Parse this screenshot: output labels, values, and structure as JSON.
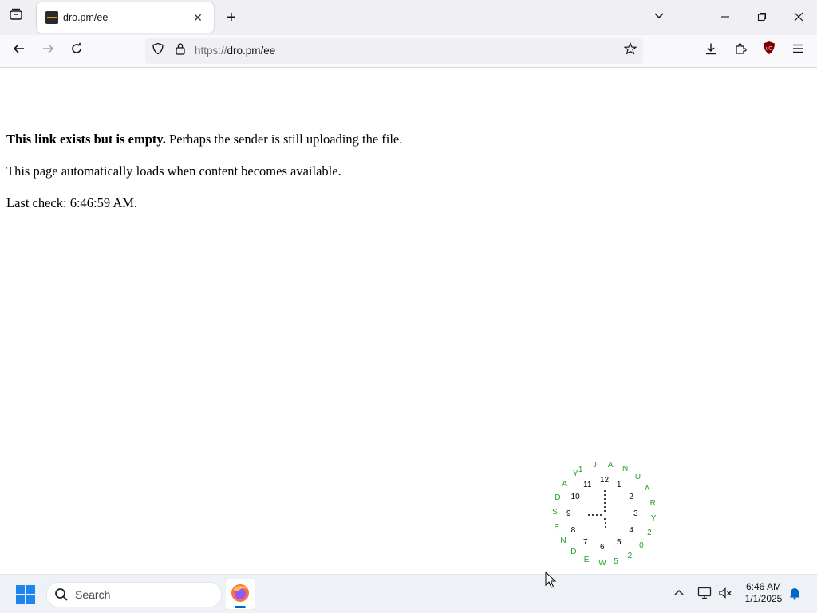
{
  "browser": {
    "tab_title": "dro.pm/ee",
    "url_scheme": "https://",
    "url_host": "dro.pm/ee",
    "ublock_label": "uO"
  },
  "page": {
    "line1_bold": "This link exists but is empty.",
    "line1_rest": " Perhaps the sender is still uploading the file.",
    "line2": "This page automatically loads when content becomes available.",
    "line3": "Last check: 6:46:59 AM."
  },
  "clock": {
    "numerals": [
      "12",
      "1",
      "2",
      "3",
      "4",
      "5",
      "6",
      "7",
      "8",
      "9",
      "10",
      "11"
    ],
    "date_text": "1JANUARY2025WEDNESDAY",
    "colors": {
      "numerals": "#000000",
      "date_ring": "#22a022"
    }
  },
  "taskbar": {
    "search_placeholder": "Search",
    "time": "6:46 AM",
    "date": "1/1/2025"
  },
  "icons": [
    "tab-list-icon",
    "close-tab-icon",
    "new-tab-icon",
    "list-all-tabs-icon",
    "minimize-icon",
    "maximize-icon",
    "close-window-icon",
    "back-icon",
    "forward-icon",
    "reload-icon",
    "shield-icon",
    "lock-icon",
    "bookmark-star-icon",
    "download-icon",
    "extensions-icon",
    "ublock-icon",
    "menu-icon",
    "windows-start-icon",
    "search-icon",
    "firefox-icon",
    "show-hidden-icons",
    "network-icon",
    "volume-muted-icon",
    "notification-bell-icon"
  ]
}
